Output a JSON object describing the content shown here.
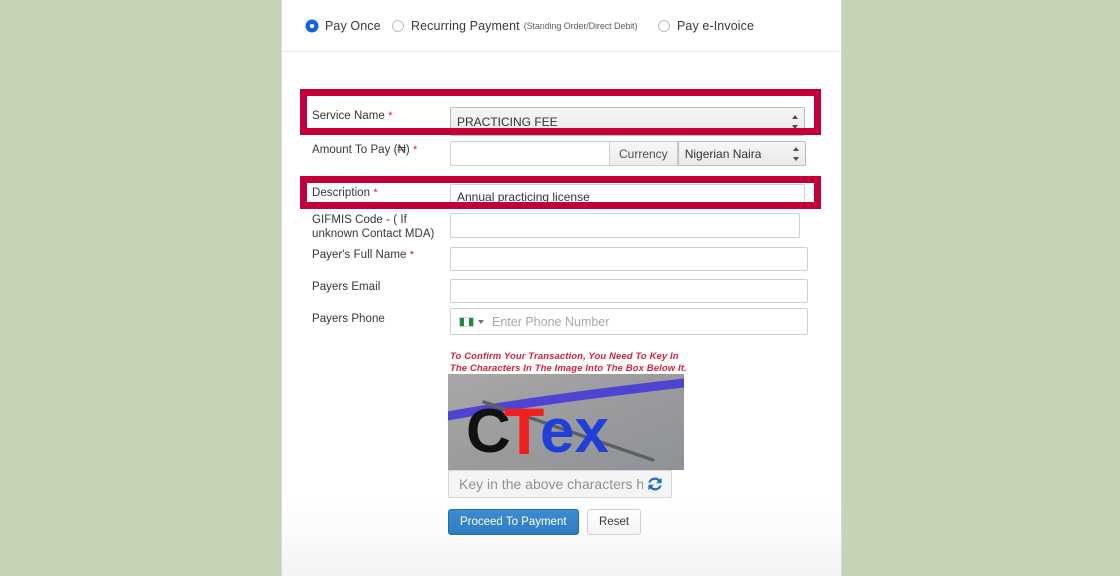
{
  "payment_type": {
    "options": [
      {
        "label": "Pay Once",
        "sub": "",
        "selected": true
      },
      {
        "label": "Recurring Payment",
        "sub": "(Standing Order/Direct Debit)",
        "selected": false
      },
      {
        "label": "Pay e-Invoice",
        "sub": "",
        "selected": false
      }
    ]
  },
  "form": {
    "service_name": {
      "label": "Service Name",
      "required_mark": "*",
      "value": "PRACTICING FEE"
    },
    "amount": {
      "label": "Amount To Pay (₦)",
      "required_mark": "*",
      "value": "",
      "placeholder": "",
      "currency_addon": "Currency",
      "currency_value": "Nigerian Naira"
    },
    "description": {
      "label": "Description",
      "required_mark": "*",
      "value": "Annual practicing license"
    },
    "gifmis": {
      "label": "GIFMIS Code - ( If unknown Contact MDA)",
      "value": ""
    },
    "payer_name": {
      "label": "Payer's Full Name",
      "required_mark": "*",
      "value": ""
    },
    "payer_email": {
      "label": "Payers Email",
      "value": ""
    },
    "payer_phone": {
      "label": "Payers Phone",
      "value": "",
      "placeholder": "Enter Phone Number",
      "country_flag": "nigeria-flag-icon"
    }
  },
  "captcha": {
    "note": "To Confirm Your Transaction, You Need To Key In The Characters In The Image Into The Box Below It.",
    "image_text": "CTex",
    "input_value": "",
    "input_placeholder": "Key in the above characters here",
    "refresh_icon": "refresh-icon"
  },
  "actions": {
    "proceed_label": "Proceed To Payment",
    "reset_label": "Reset"
  },
  "colors": {
    "page_background": "#c6d4b6",
    "highlight": "#c2003c",
    "primary_button": "#2f7ec4",
    "note_text": "#d0223f",
    "required": "#c32148"
  }
}
